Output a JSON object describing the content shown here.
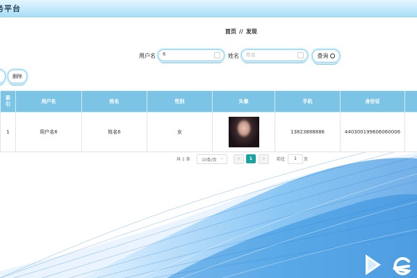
{
  "app": {
    "title": "务平台"
  },
  "breadcrumb": {
    "home": "首页",
    "separator": "//",
    "current": "发现"
  },
  "search": {
    "username_label": "用户名",
    "username_value": "6",
    "name_label": "姓名",
    "name_placeholder": "姓名",
    "query_button": "查询"
  },
  "actions": {
    "delete_button": "删除"
  },
  "table": {
    "headers": [
      "索引",
      "用户名",
      "姓名",
      "性别",
      "头像",
      "手机",
      "身份证"
    ],
    "rows": [
      {
        "index": "1",
        "username": "用户名6",
        "name": "姓名6",
        "gender": "女",
        "phone": "13823888886",
        "id_card": "440300199606060006"
      }
    ]
  },
  "pagination": {
    "total_prefix": "共",
    "total": "1",
    "total_suffix": "条",
    "page_size": "10条/页",
    "prev": "<",
    "current_page": "1",
    "next": ">",
    "goto_prefix": "前往",
    "goto_value": "1",
    "goto_suffix": "页"
  },
  "colors": {
    "header_bar": "#a7ddf6",
    "table_header": "#7cc4e6",
    "accent_teal": "#1aa3a0",
    "wave_blue": "#1e90e0"
  },
  "icons": [
    "search-icon",
    "calendar-icon",
    "dropdown-arrow-icon",
    "logo-icon"
  ]
}
